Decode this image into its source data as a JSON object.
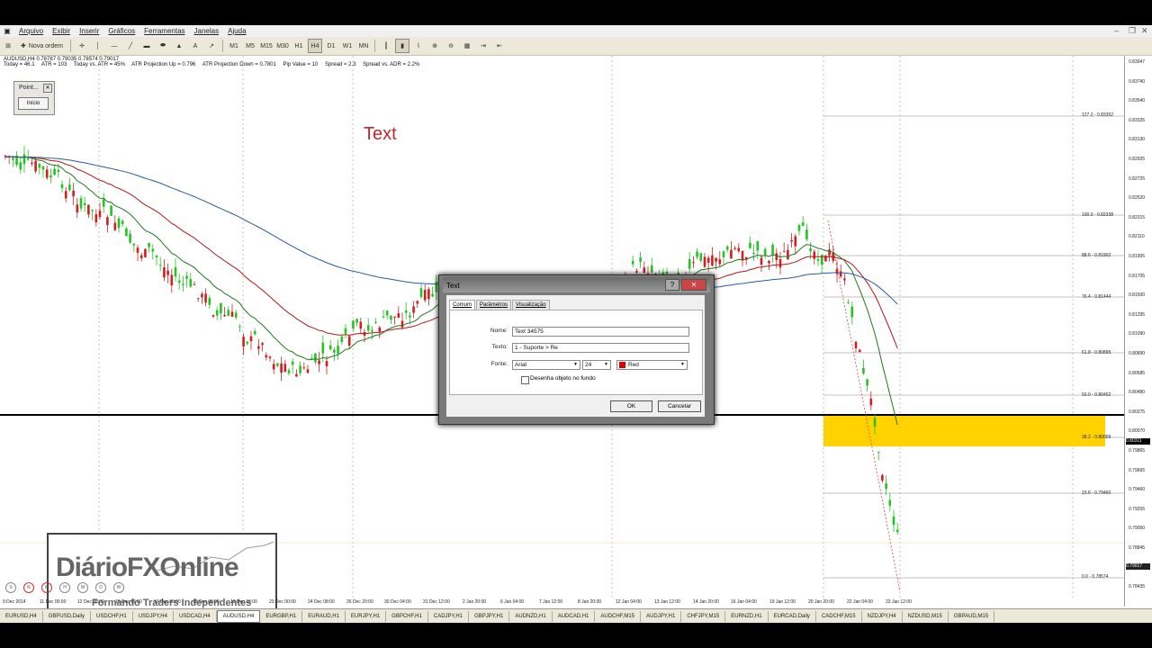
{
  "menu": [
    "Arquivo",
    "Exibir",
    "Inserir",
    "Gráficos",
    "Ferramentas",
    "Janelas",
    "Ajuda"
  ],
  "toolbar": {
    "new_order": "Nova ordem",
    "timeframes": [
      "M1",
      "M5",
      "M15",
      "M30",
      "H1",
      "H4",
      "D1",
      "W1",
      "MN"
    ],
    "active_timeframe": "H4"
  },
  "chart": {
    "symbol_line": "AUDUSD,H4  0.78787 0.79035 0.78574 0.79017",
    "stats": [
      "Today = 46.1",
      "ATR = 103",
      "Today vs. ATR = 45%",
      "ATR Projection Up = 0.796",
      "ATR Projection Down = 0.7801",
      "Pip Value = 10",
      "Spread = 2.3",
      "Spread vs. ADR = 2.2%"
    ],
    "text_object": "Text",
    "current_price": "0.80311",
    "bid_price": "0.79017"
  },
  "point_panel": {
    "title": "Point...",
    "button": "Início"
  },
  "logo": {
    "line1": "DiárioFXOnline",
    "line2": "Formando Traders Independentes"
  },
  "price_labels": [
    "0.83947",
    "0.83740",
    "0.83540",
    "0.83335",
    "0.83130",
    "0.82925",
    "0.82725",
    "0.82520",
    "0.82315",
    "0.82110",
    "0.81905",
    "0.81705",
    "0.81500",
    "0.81295",
    "0.81090",
    "0.80890",
    "0.80685",
    "0.80480",
    "0.80275",
    "0.80070",
    "0.79865",
    "0.79665",
    "0.79460",
    "0.79255",
    "0.79050",
    "0.78845",
    "0.78640",
    "0.78435"
  ],
  "fibo": [
    {
      "label": "127.2 - 0.83352"
    },
    {
      "label": "100.0 - 0.82338"
    },
    {
      "label": "88.6 - 0.81902"
    },
    {
      "label": "76.4 - 0.81444"
    },
    {
      "label": "61.8 - 0.80895"
    },
    {
      "label": "50.0 - 0.80452"
    },
    {
      "label": "38.2 - 0.80009"
    },
    {
      "label": "23.6 - 0.79460"
    },
    {
      "label": "0.0 - 0.78574"
    }
  ],
  "dates": [
    "9 Dec 2014",
    "11 Dec 00:00",
    "12 Dec 08:00",
    "15 Dec 16:00",
    "17 Dec 00:00",
    "18 Dec 08:00",
    "19 Dec 16:00",
    "23 Dec 00:00",
    "24 Dec 08:00",
    "26 Dec 20:00",
    "30 Dec 04:00",
    "31 Dec 12:00",
    "2 Jan 20:00",
    "6 Jan 04:00",
    "7 Jan 12:00",
    "8 Jan 20:00",
    "12 Jan 04:00",
    "13 Jan 12:00",
    "14 Jan 20:00",
    "16 Jan 04:00",
    "19 Jan 12:00",
    "20 Jan 20:00",
    "22 Jan 04:00",
    "23 Jan 12:00"
  ],
  "symbol_tabs": [
    "EURUSD,H4",
    "GBPUSD,Daily",
    "USDCHF,H1",
    "USDJPY,H4",
    "USDCAD,H4",
    "AUDUSD,H4",
    "EURGBP,H1",
    "EURAUD,H1",
    "EURJPY,H1",
    "GBPCHF,H1",
    "CADJPY,H1",
    "GBPJPY,H1",
    "AUDNZD,H1",
    "AUDCAD,H1",
    "AUDCHF,M15",
    "AUDJPY,H1",
    "CHFJPY,M15",
    "EURNZD,H1",
    "EURCAD,Daily",
    "CADCHF,M15",
    "NZDJPY,H4",
    "NZDUSD,M15",
    "GBPAUD,M15"
  ],
  "active_tab": "AUDUSD,H4",
  "dialog": {
    "title": "Text",
    "tabs": [
      "Comum",
      "Parâmetros",
      "Visualização"
    ],
    "name_label": "Nome:",
    "name_value": "Text 34575",
    "text_label": "Texto:",
    "text_value": "1 - Suporte > Re",
    "font_label": "Fonte:",
    "font_value": "Arial",
    "size_value": "24",
    "color_value": "Red",
    "background_label": "Desenha objeto no fundo",
    "ok": "OK",
    "cancel": "Cancelar",
    "help": "?"
  },
  "colors": {
    "ma_fast": "#1a7a1a",
    "ma_mid": "#b01818",
    "ma_slow": "#2a5aa0",
    "zone": "#ffd200",
    "text_red": "#c0282e"
  }
}
